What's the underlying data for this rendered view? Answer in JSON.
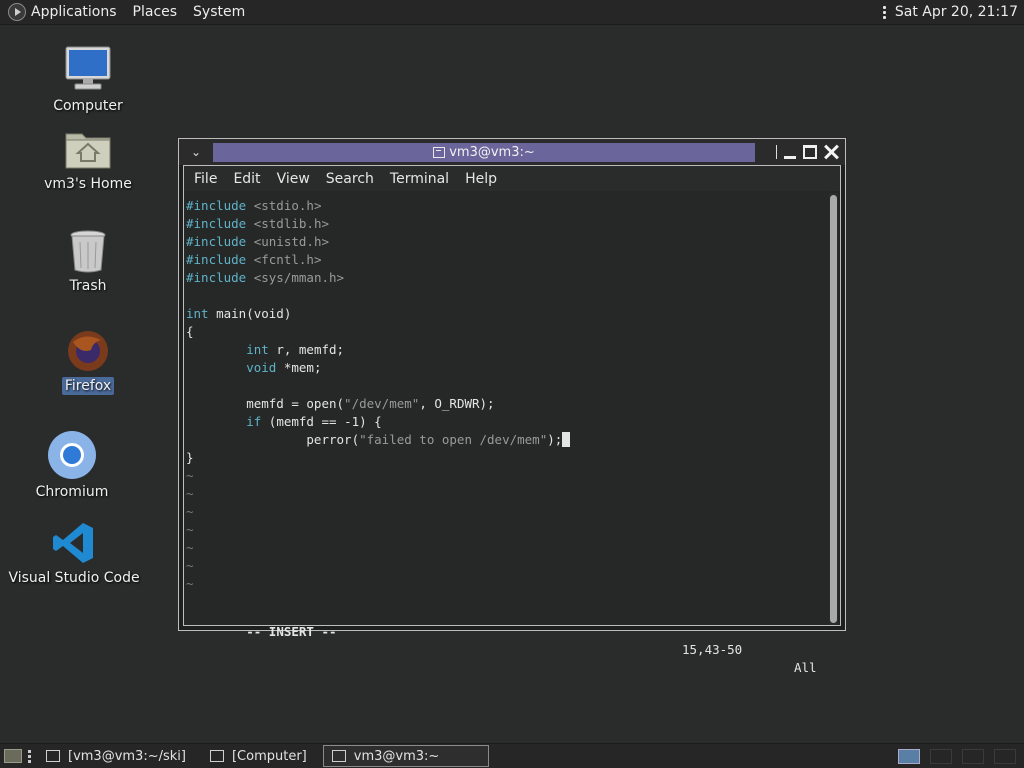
{
  "top_panel": {
    "applications": "Applications",
    "places": "Places",
    "system": "System",
    "clock": "Sat Apr 20, 21:17"
  },
  "desktop": {
    "icons": [
      {
        "label": "Computer"
      },
      {
        "label": "vm3's Home"
      },
      {
        "label": "Trash"
      },
      {
        "label": "Firefox"
      },
      {
        "label": "Chromium"
      },
      {
        "label": "Visual Studio Code"
      }
    ]
  },
  "window": {
    "title": "vm3@vm3:~",
    "menu": [
      "File",
      "Edit",
      "View",
      "Search",
      "Terminal",
      "Help"
    ]
  },
  "editor": {
    "lines": [
      [
        {
          "t": "#include ",
          "c": "kw"
        },
        {
          "t": "<stdio.h>",
          "c": "str"
        }
      ],
      [
        {
          "t": "#include ",
          "c": "kw"
        },
        {
          "t": "<stdlib.h>",
          "c": "str"
        }
      ],
      [
        {
          "t": "#include ",
          "c": "kw"
        },
        {
          "t": "<unistd.h>",
          "c": "str"
        }
      ],
      [
        {
          "t": "#include ",
          "c": "kw"
        },
        {
          "t": "<fcntl.h>",
          "c": "str"
        }
      ],
      [
        {
          "t": "#include ",
          "c": "kw"
        },
        {
          "t": "<sys/mman.h>",
          "c": "str"
        }
      ],
      [],
      [
        {
          "t": "int",
          "c": "kw"
        },
        {
          "t": " main(void)"
        }
      ],
      [
        {
          "t": "{"
        }
      ],
      [
        {
          "t": "        "
        },
        {
          "t": "int",
          "c": "kw"
        },
        {
          "t": " r, memfd;"
        }
      ],
      [
        {
          "t": "        "
        },
        {
          "t": "void",
          "c": "kw"
        },
        {
          "t": " *mem;"
        }
      ],
      [],
      [
        {
          "t": "        memfd = open("
        },
        {
          "t": "\"/dev/mem\"",
          "c": "str"
        },
        {
          "t": ", O_RDWR);"
        }
      ],
      [
        {
          "t": "        "
        },
        {
          "t": "if",
          "c": "kw"
        },
        {
          "t": " (memfd == -1) {"
        }
      ],
      [
        {
          "t": "                perror("
        },
        {
          "t": "\"failed to open /dev/mem\"",
          "c": "str"
        },
        {
          "t": ");"
        },
        {
          "t": " ",
          "c": "cursor"
        }
      ],
      [
        {
          "t": "}"
        }
      ],
      [
        {
          "t": "~",
          "c": "tilde"
        }
      ],
      [
        {
          "t": "~",
          "c": "tilde"
        }
      ],
      [
        {
          "t": "~",
          "c": "tilde"
        }
      ],
      [
        {
          "t": "~",
          "c": "tilde"
        }
      ],
      [
        {
          "t": "~",
          "c": "tilde"
        }
      ],
      [
        {
          "t": "~",
          "c": "tilde"
        }
      ],
      [
        {
          "t": "~",
          "c": "tilde"
        }
      ]
    ],
    "status": {
      "mode": "-- INSERT --",
      "position": "15,43-50",
      "percent": "All"
    }
  },
  "taskbar": {
    "tasks": [
      {
        "label": "[vm3@vm3:~/ski]"
      },
      {
        "label": "[Computer]"
      },
      {
        "label": "vm3@vm3:~"
      }
    ]
  }
}
